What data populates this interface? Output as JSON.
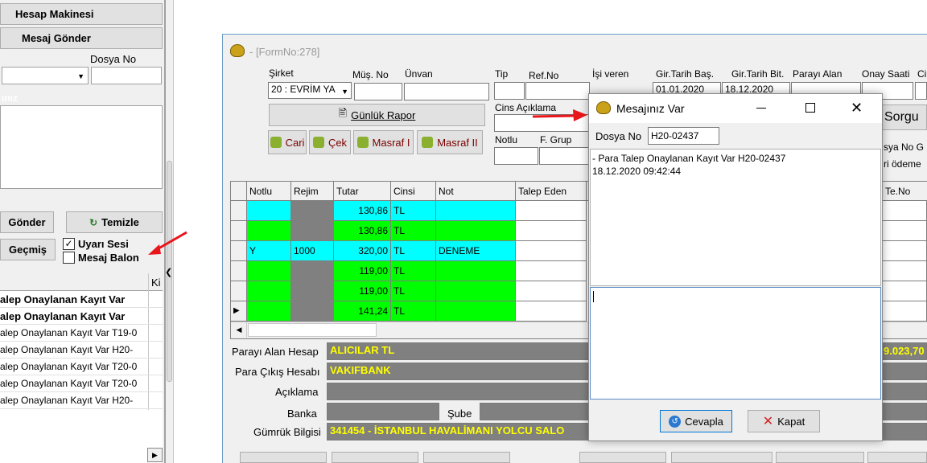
{
  "left": {
    "btn_calc": "Hesap Makinesi",
    "btn_send_msg": "Mesaj Gönder",
    "dosya_label": "Dosya No",
    "section_label": "ınız",
    "btn_send": "Gönder",
    "btn_clear": "Temizle",
    "btn_history": "Geçmiş",
    "chk_sound": "Uyarı Sesi",
    "chk_balloon": "Mesaj Balon",
    "col_ki": "Ki",
    "list": [
      "alep Onaylanan Kayıt Var",
      "alep Onaylanan Kayıt Var",
      "alep Onaylanan Kayıt Var T19-0",
      "alep Onaylanan Kayıt Var H20-",
      "alep Onaylanan Kayıt Var T20-0",
      "alep Onaylanan Kayıt Var T20-0",
      "alep Onaylanan Kayıt Var H20-"
    ]
  },
  "form": {
    "title": "- [FormNo:278]",
    "sirket_label": "Şirket",
    "sirket_value": "20 : EVRİM YA",
    "mus_no": "Müş. No",
    "unvan": "Ünvan",
    "tip": "Tip",
    "ref_no": "Ref.No",
    "isi_veren": "İşi veren",
    "gir_tarih_bas": "Gir.Tarih Baş.",
    "gir_tarih_bas_val": "01.01.2020",
    "gir_tarih_bit": "Gir.Tarih Bit.",
    "gir_tarih_bit_val": "18.12.2020",
    "parayi_alan": "Parayı Alan",
    "onay_saati": "Onay Saati",
    "onay_ci": "Ci",
    "gunluk_rapor": "Günlük Rapor",
    "cari": "Cari",
    "cek": "Çek",
    "masraf1": "Masraf I",
    "masraf2": "Masraf II",
    "cins_aciklama": "Cins Açıklama",
    "notlu": "Notlu",
    "f_grup": "F. Grup",
    "sorgu": "Sorgu",
    "dosya_no_g": "sya No G",
    "odeme": "ri ödeme",
    "te_no": "Te.No"
  },
  "grid": {
    "headers": [
      "Notlu",
      "Rejim",
      "Tutar",
      "Cinsi",
      "Not",
      "Talep Eden"
    ],
    "rows": [
      {
        "notlu": "",
        "rejim": "",
        "tutar": "130,86",
        "cinsi": "TL",
        "not": "",
        "bg": "#00ffff"
      },
      {
        "notlu": "",
        "rejim": "",
        "tutar": "130,86",
        "cinsi": "TL",
        "not": "",
        "bg": "#00ff00"
      },
      {
        "notlu": "Y",
        "rejim": "1000",
        "tutar": "320,00",
        "cinsi": "TL",
        "not": "DENEME",
        "bg": "#00ffff"
      },
      {
        "notlu": "",
        "rejim": "",
        "tutar": "119,00",
        "cinsi": "TL",
        "not": "",
        "bg": "#00ff00"
      },
      {
        "notlu": "",
        "rejim": "",
        "tutar": "119,00",
        "cinsi": "TL",
        "not": "",
        "bg": "#00ff00"
      },
      {
        "notlu": "",
        "rejim": "",
        "tutar": "141,24",
        "cinsi": "TL",
        "not": "",
        "bg": "#00ff00"
      }
    ]
  },
  "bottom": {
    "parayi_alan_hesap": "Parayı Alan Hesap",
    "parayi_alan_val": "ALICILAR TL",
    "para_cikis": "Para Çıkış Hesabı",
    "para_cikis_val": "VAKIFBANK",
    "aciklama": "Açıklama",
    "banka": "Banka",
    "sube": "Şube",
    "gumruk": "Gümrük Bilgisi",
    "gumruk_val": "341454 - İSTANBUL HAVALİMANI YOLCU SALO",
    "amount": "9.023,70"
  },
  "dialog": {
    "title": "Mesajınız Var",
    "dosya_label": "Dosya No",
    "dosya_value": "H20-02437",
    "message_line1": "- Para Talep Onaylanan Kayıt Var H20-02437",
    "message_line2": "18.12.2020 09:42:44",
    "btn_reply": "Cevapla",
    "btn_close": "Kapat"
  },
  "colors": {
    "cyan": "#00ffff",
    "green": "#00ff00",
    "gray": "#808080",
    "yellow": "#ffff00",
    "red_arrow": "#e8151b"
  }
}
